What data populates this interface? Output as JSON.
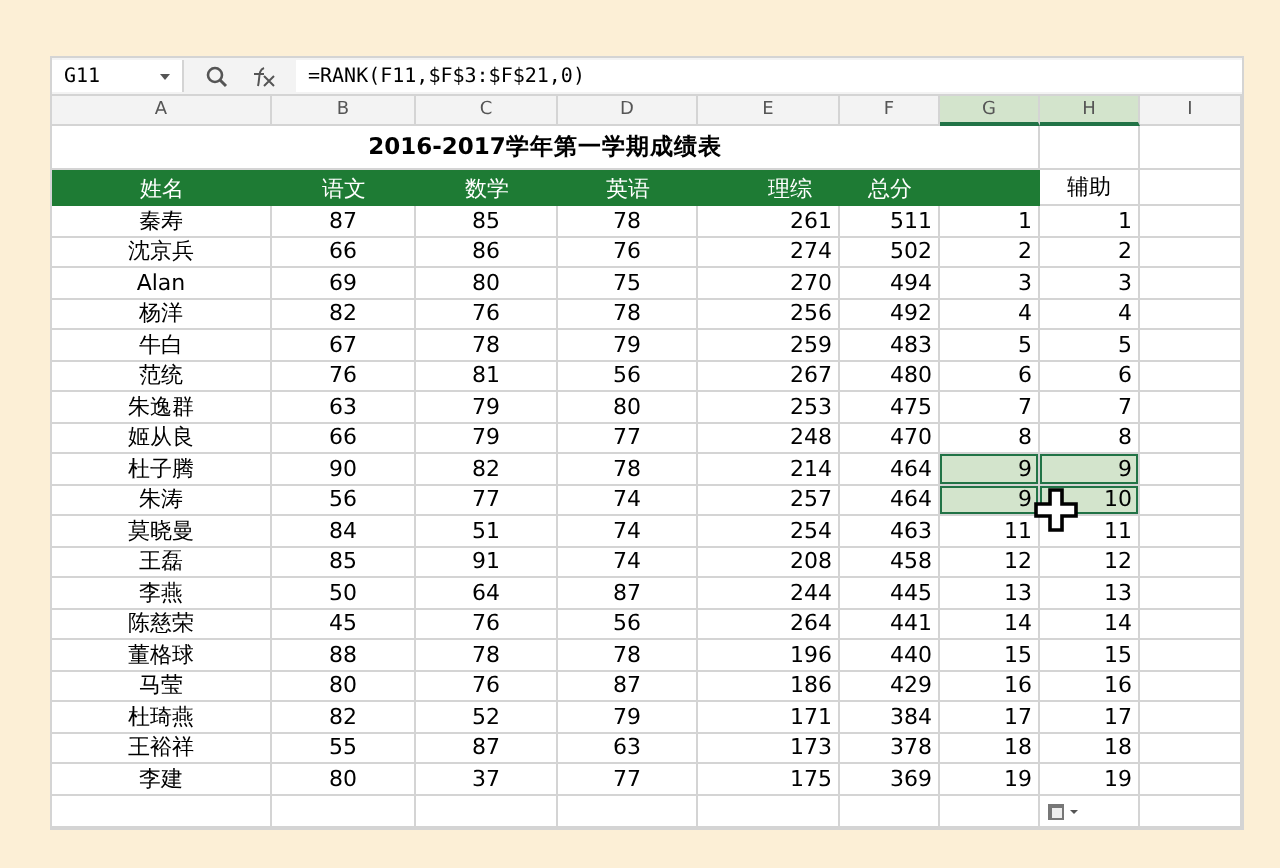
{
  "name_box": "G11",
  "formula": "=RANK(F11,$F$3:$F$21,0)",
  "columns": [
    {
      "label": "A",
      "selected": false
    },
    {
      "label": "B",
      "selected": false
    },
    {
      "label": "C",
      "selected": false
    },
    {
      "label": "D",
      "selected": false
    },
    {
      "label": "E",
      "selected": false
    },
    {
      "label": "F",
      "selected": false
    },
    {
      "label": "G",
      "selected": true
    },
    {
      "label": "H",
      "selected": true
    },
    {
      "label": "I",
      "selected": false
    }
  ],
  "title": "2016-2017学年第一学期成绩表",
  "headers": [
    "姓名",
    "语文",
    "数学",
    "英语",
    "理综",
    "总分"
  ],
  "helper_header": "辅助",
  "rows": [
    {
      "cells": [
        "秦寿",
        "87",
        "85",
        "78",
        "261",
        "511",
        "1",
        "1"
      ],
      "selected": false
    },
    {
      "cells": [
        "沈京兵",
        "66",
        "86",
        "76",
        "274",
        "502",
        "2",
        "2"
      ],
      "selected": false
    },
    {
      "cells": [
        "Alan",
        "69",
        "80",
        "75",
        "270",
        "494",
        "3",
        "3"
      ],
      "selected": false
    },
    {
      "cells": [
        "杨洋",
        "82",
        "76",
        "78",
        "256",
        "492",
        "4",
        "4"
      ],
      "selected": false
    },
    {
      "cells": [
        "牛白",
        "67",
        "78",
        "79",
        "259",
        "483",
        "5",
        "5"
      ],
      "selected": false
    },
    {
      "cells": [
        "范统",
        "76",
        "81",
        "56",
        "267",
        "480",
        "6",
        "6"
      ],
      "selected": false
    },
    {
      "cells": [
        "朱逸群",
        "63",
        "79",
        "80",
        "253",
        "475",
        "7",
        "7"
      ],
      "selected": false
    },
    {
      "cells": [
        "姬从良",
        "66",
        "79",
        "77",
        "248",
        "470",
        "8",
        "8"
      ],
      "selected": false
    },
    {
      "cells": [
        "杜子腾",
        "90",
        "82",
        "78",
        "214",
        "464",
        "9",
        "9"
      ],
      "selected": true
    },
    {
      "cells": [
        "朱涛",
        "56",
        "77",
        "74",
        "257",
        "464",
        "9",
        "10"
      ],
      "selected": true
    },
    {
      "cells": [
        "莫晓曼",
        "84",
        "51",
        "74",
        "254",
        "463",
        "11",
        "11"
      ],
      "selected": false
    },
    {
      "cells": [
        "王磊",
        "85",
        "91",
        "74",
        "208",
        "458",
        "12",
        "12"
      ],
      "selected": false
    },
    {
      "cells": [
        "李燕",
        "50",
        "64",
        "87",
        "244",
        "445",
        "13",
        "13"
      ],
      "selected": false
    },
    {
      "cells": [
        "陈慈荣",
        "45",
        "76",
        "56",
        "264",
        "441",
        "14",
        "14"
      ],
      "selected": false
    },
    {
      "cells": [
        "董格球",
        "88",
        "78",
        "78",
        "196",
        "440",
        "15",
        "15"
      ],
      "selected": false
    },
    {
      "cells": [
        "马莹",
        "80",
        "76",
        "87",
        "186",
        "429",
        "16",
        "16"
      ],
      "selected": false
    },
    {
      "cells": [
        "杜琦燕",
        "82",
        "52",
        "79",
        "171",
        "384",
        "17",
        "17"
      ],
      "selected": false
    },
    {
      "cells": [
        "王裕祥",
        "55",
        "87",
        "63",
        "173",
        "378",
        "18",
        "18"
      ],
      "selected": false
    },
    {
      "cells": [
        "李建",
        "80",
        "37",
        "77",
        "175",
        "369",
        "19",
        "19"
      ],
      "selected": false
    }
  ]
}
